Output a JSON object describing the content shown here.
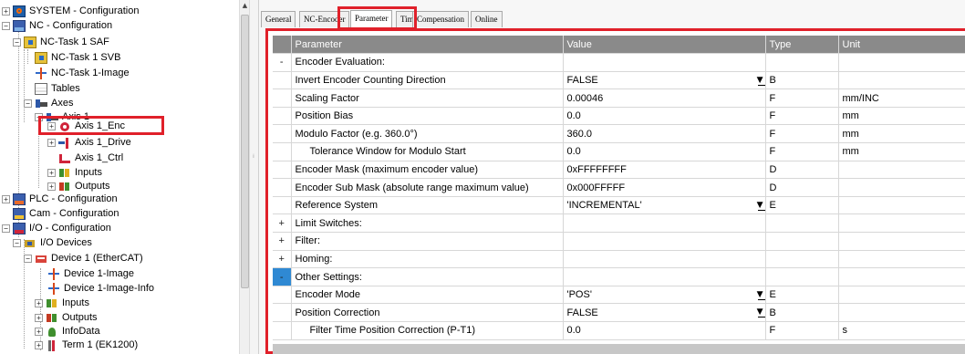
{
  "tree": {
    "nodes": [
      {
        "label": "SYSTEM - Configuration",
        "icon": "system-config-icon"
      },
      {
        "label": "NC - Configuration",
        "icon": "nc-config-icon"
      },
      {
        "label": "NC-Task 1 SAF",
        "icon": "task-icon"
      },
      {
        "label": "NC-Task 1 SVB",
        "icon": "task-icon"
      },
      {
        "label": "NC-Task 1-Image",
        "icon": "image-icon"
      },
      {
        "label": "Tables",
        "icon": "table-icon"
      },
      {
        "label": "Axes",
        "icon": "axes-icon"
      },
      {
        "label": "Axis 1",
        "icon": "axis-icon"
      },
      {
        "label": "Axis 1_Enc",
        "icon": "encoder-icon"
      },
      {
        "label": "Axis 1_Drive",
        "icon": "drive-icon"
      },
      {
        "label": "Axis 1_Ctrl",
        "icon": "controller-icon"
      },
      {
        "label": "Inputs",
        "icon": "inputs-icon"
      },
      {
        "label": "Outputs",
        "icon": "outputs-icon"
      },
      {
        "label": "PLC - Configuration",
        "icon": "plc-config-icon"
      },
      {
        "label": "Cam - Configuration",
        "icon": "cam-config-icon"
      },
      {
        "label": "I/O - Configuration",
        "icon": "io-config-icon"
      },
      {
        "label": "I/O Devices",
        "icon": "io-devices-icon"
      },
      {
        "label": "Device 1 (EtherCAT)",
        "icon": "ethercat-icon"
      },
      {
        "label": "Device 1-Image",
        "icon": "image-icon"
      },
      {
        "label": "Device 1-Image-Info",
        "icon": "image-icon"
      },
      {
        "label": "Inputs",
        "icon": "inputs-icon"
      },
      {
        "label": "Outputs",
        "icon": "outputs-icon"
      },
      {
        "label": "InfoData",
        "icon": "infodata-icon"
      },
      {
        "label": "Term 1 (EK1200)",
        "icon": "terminal-icon"
      }
    ]
  },
  "tabs": [
    "General",
    "NC-Encoder",
    "Parameter",
    "Tim",
    "Compensation",
    "Online"
  ],
  "active_tab": "Parameter",
  "grid": {
    "headers": [
      "Parameter",
      "Value",
      "Type",
      "Unit"
    ],
    "rows": [
      {
        "exp": "-",
        "name": "Encoder Evaluation:",
        "value": "",
        "type": "",
        "unit": ""
      },
      {
        "exp": "",
        "name": "Invert Encoder Counting Direction",
        "value": "FALSE",
        "type": "B",
        "unit": ""
      },
      {
        "exp": "",
        "name": "Scaling Factor",
        "value": "0.00046",
        "type": "F",
        "unit": "mm/INC"
      },
      {
        "exp": "",
        "name": "Position Bias",
        "value": "0.0",
        "type": "F",
        "unit": "mm"
      },
      {
        "exp": "",
        "name": "Modulo Factor (e.g. 360.0°)",
        "value": "360.0",
        "type": "F",
        "unit": "mm"
      },
      {
        "exp": "",
        "name": "Tolerance Window for Modulo Start",
        "value": "0.0",
        "type": "F",
        "unit": "mm"
      },
      {
        "exp": "",
        "name": "Encoder Mask (maximum encoder value)",
        "value": "0xFFFFFFFF",
        "type": "D",
        "unit": ""
      },
      {
        "exp": "",
        "name": "Encoder Sub Mask (absolute range maximum value)",
        "value": "0x000FFFFF",
        "type": "D",
        "unit": ""
      },
      {
        "exp": "",
        "name": "Reference System",
        "value": "'INCREMENTAL'",
        "type": "E",
        "unit": ""
      },
      {
        "exp": "+",
        "name": "Limit Switches:",
        "value": "",
        "type": "",
        "unit": ""
      },
      {
        "exp": "+",
        "name": "Filter:",
        "value": "",
        "type": "",
        "unit": ""
      },
      {
        "exp": "+",
        "name": "Homing:",
        "value": "",
        "type": "",
        "unit": ""
      },
      {
        "exp": "-",
        "name": "Other Settings:",
        "value": "",
        "type": "",
        "unit": ""
      },
      {
        "exp": "",
        "name": "Encoder Mode",
        "value": "'POS'",
        "type": "E",
        "unit": ""
      },
      {
        "exp": "",
        "name": "Position Correction",
        "value": "FALSE",
        "type": "B",
        "unit": ""
      },
      {
        "exp": "",
        "name": "Filter Time Position Correction (P-T1)",
        "value": "0.0",
        "type": "F",
        "unit": "s"
      }
    ]
  }
}
